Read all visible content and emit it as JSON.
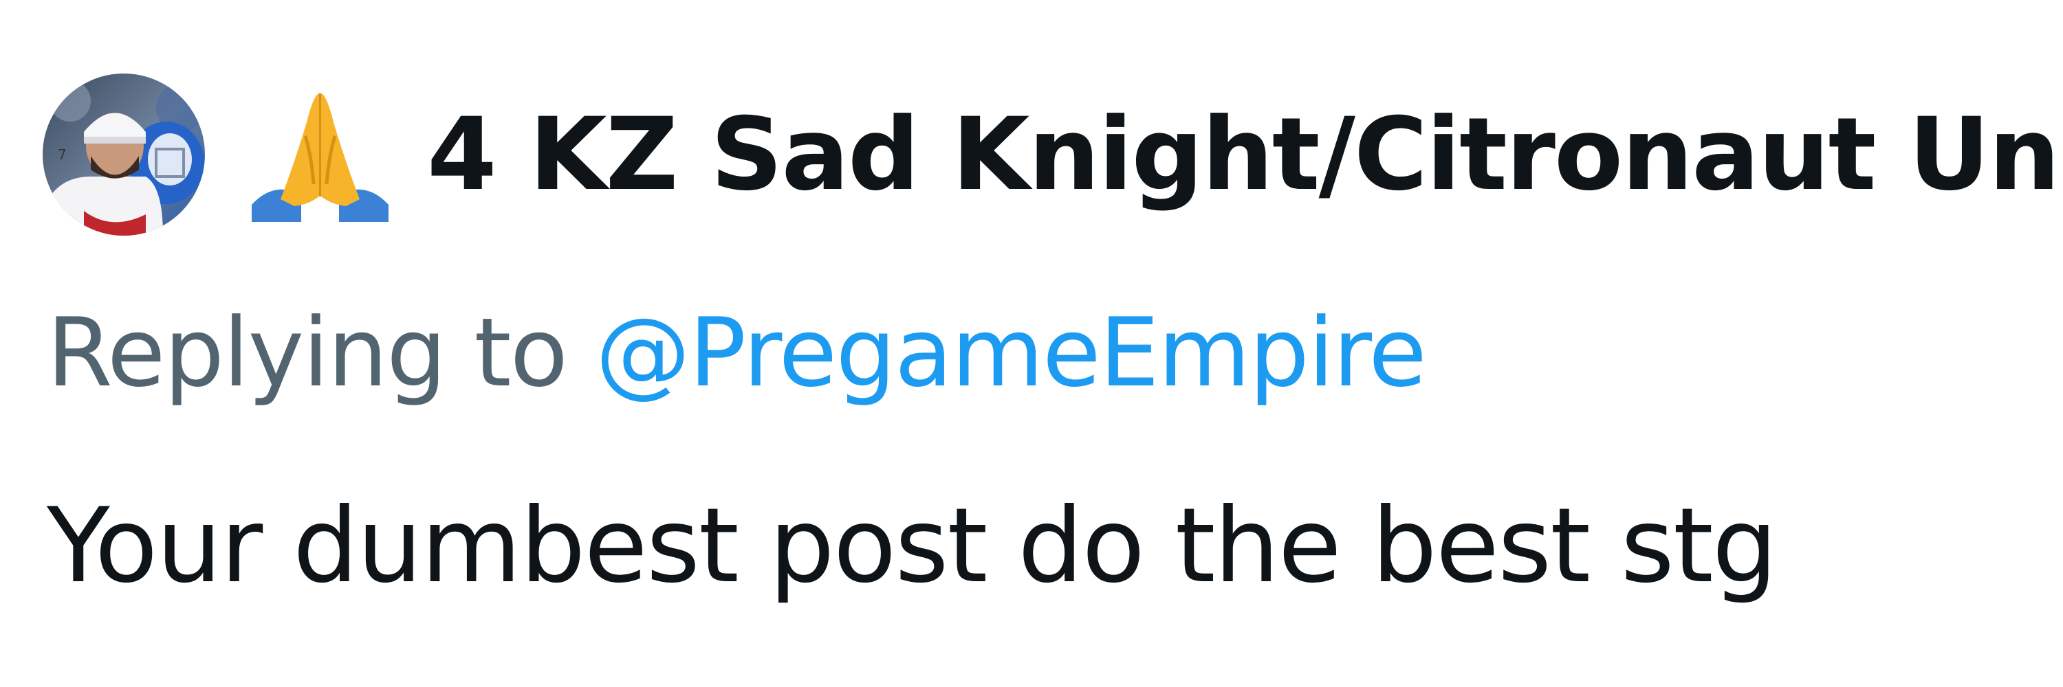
{
  "author": {
    "avatar_icon": "avatar-hockey-player",
    "emoji_icon": "folded-hands-emoji",
    "display_name": "4 KZ Sad Knight/Citronaut Un"
  },
  "reply": {
    "label": "Replying to",
    "handle": "@PregameEmpire"
  },
  "tweet": {
    "text": "Your dumbest post do the best stg"
  },
  "colors": {
    "text_primary": "#0f1419",
    "text_secondary": "#536471",
    "link": "#1d9bf0"
  }
}
